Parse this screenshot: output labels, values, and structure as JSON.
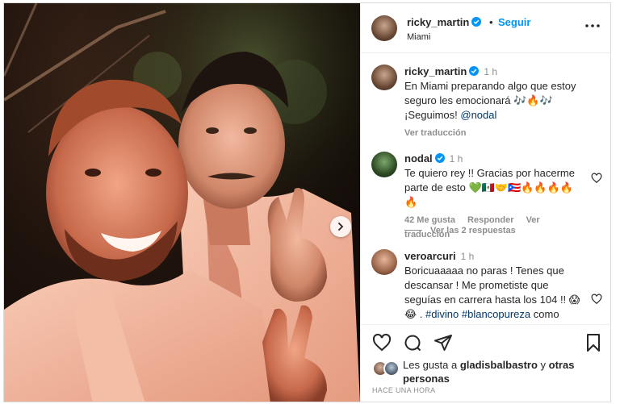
{
  "post": {
    "username": "ricky_martin",
    "follow_label": "Seguir",
    "separator": "•",
    "location": "Miami",
    "more_icon": "ellipsis-icon"
  },
  "caption": {
    "username": "ricky_martin",
    "time": "1 h",
    "text_1": "En Miami preparando algo que estoy seguro les emocionará 🎶🔥🎶",
    "text_2": "¡Seguimos! ",
    "mention": "@nodal",
    "translation": "Ver traducción"
  },
  "comments": [
    {
      "username": "nodal",
      "time": "1 h",
      "text": "Te quiero rey !! Gracias por hacerme parte de esto 💚🇲🇽🤝🇵🇷🔥🔥🔥🔥🔥",
      "likes": "42 Me gusta",
      "reply": "Responder",
      "translation": "Ver traducción",
      "replies": "Ver las 2 respuestas"
    },
    {
      "username": "veroarcuri",
      "time": "1 h",
      "text_1": "Boricuaaaaa no paras ! Tenes que descansar ! Me prometiste que seguías en carrera hasta los 104 !! 😱😂 . ",
      "tag_1": "#divino",
      "tag_2": "#blancopureza",
      "text_2": " como"
    }
  ],
  "likes": {
    "prefix": "Les gusta a ",
    "user": "gladisbalbastro",
    "middle": " y ",
    "others": "otras personas"
  },
  "timestamp": "HACE UNA HORA",
  "colors": {
    "accent": "#0095f6",
    "verified": "#0095f6",
    "text": "#262626",
    "muted": "#8e8e8e"
  }
}
